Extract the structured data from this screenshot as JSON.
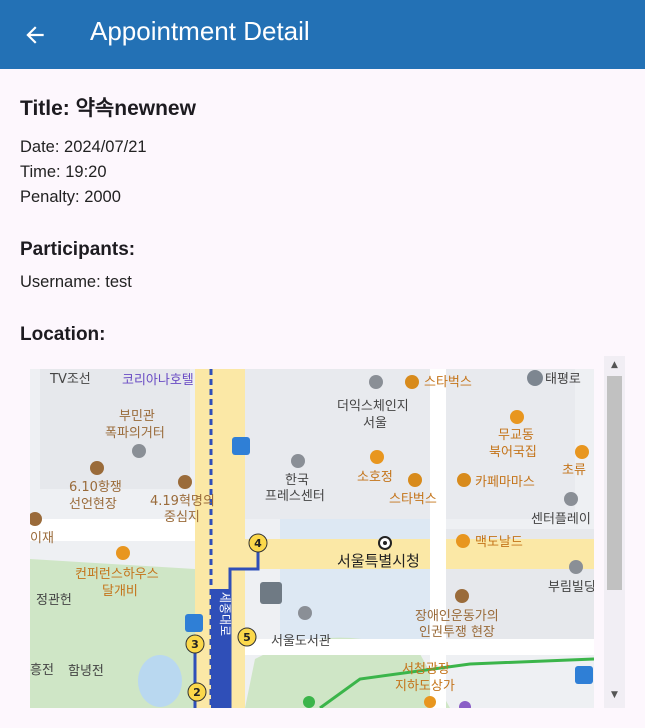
{
  "appbar": {
    "title": "Appointment Detail",
    "back_icon": "arrow-back-icon"
  },
  "detail": {
    "title": "Title: 약속newnew",
    "date": "Date: 2024/07/21",
    "time": "Time: 19:20",
    "penalty": "Penalty: 2000"
  },
  "participants": {
    "heading": "Participants:",
    "items": [
      "Username: test"
    ]
  },
  "location": {
    "heading": "Location:",
    "map_labels": {
      "tv": "TV조선",
      "koreana": "코리아나호텔",
      "starbucks1": "스타벅스",
      "taepyeong": "태평로",
      "designer": "더익스체인지",
      "seoul": "서울",
      "bumingwan1": "부민관",
      "bumingwan2": "폭파의거터",
      "mugyo1": "무교동",
      "mugyo2": "북어국집",
      "choru": "초류",
      "hanguk1": "한국",
      "hanguk2": "프레스센터",
      "sohojeong": "소호정",
      "cafe": "카페마마스",
      "sixten1": "6.10항쟁",
      "sixten2": "선언현장",
      "april1": "4.19혁명의",
      "april2": "중심지",
      "starbucks2": "스타벅스",
      "centerplace": "센터플레이",
      "ijae": "이재",
      "cityhall": "서울특별시청",
      "mcd": "맥도날드",
      "conf1": "컨퍼런스하우스",
      "conf2": "달개비",
      "jeonggwan": "정관헌",
      "burim": "부림빌딩",
      "library": "서울도서관",
      "disab1": "장애인운동가의",
      "disab2": "인권투쟁 현장",
      "hongjeon": "흥전",
      "hamnyeong": "함녕전",
      "plaza1": "서청광장",
      "plaza2": "지하도상가",
      "road": "세종대로",
      "n2": "2",
      "n3": "3",
      "n4": "4",
      "n5": "5"
    }
  },
  "colors": {
    "appbar": "#2371b5",
    "background": "#fdf7fd",
    "route": "#2f4fb8",
    "subway_green": "#3bb54a"
  },
  "scrollbar": {
    "up": "▲",
    "down": "▼"
  }
}
